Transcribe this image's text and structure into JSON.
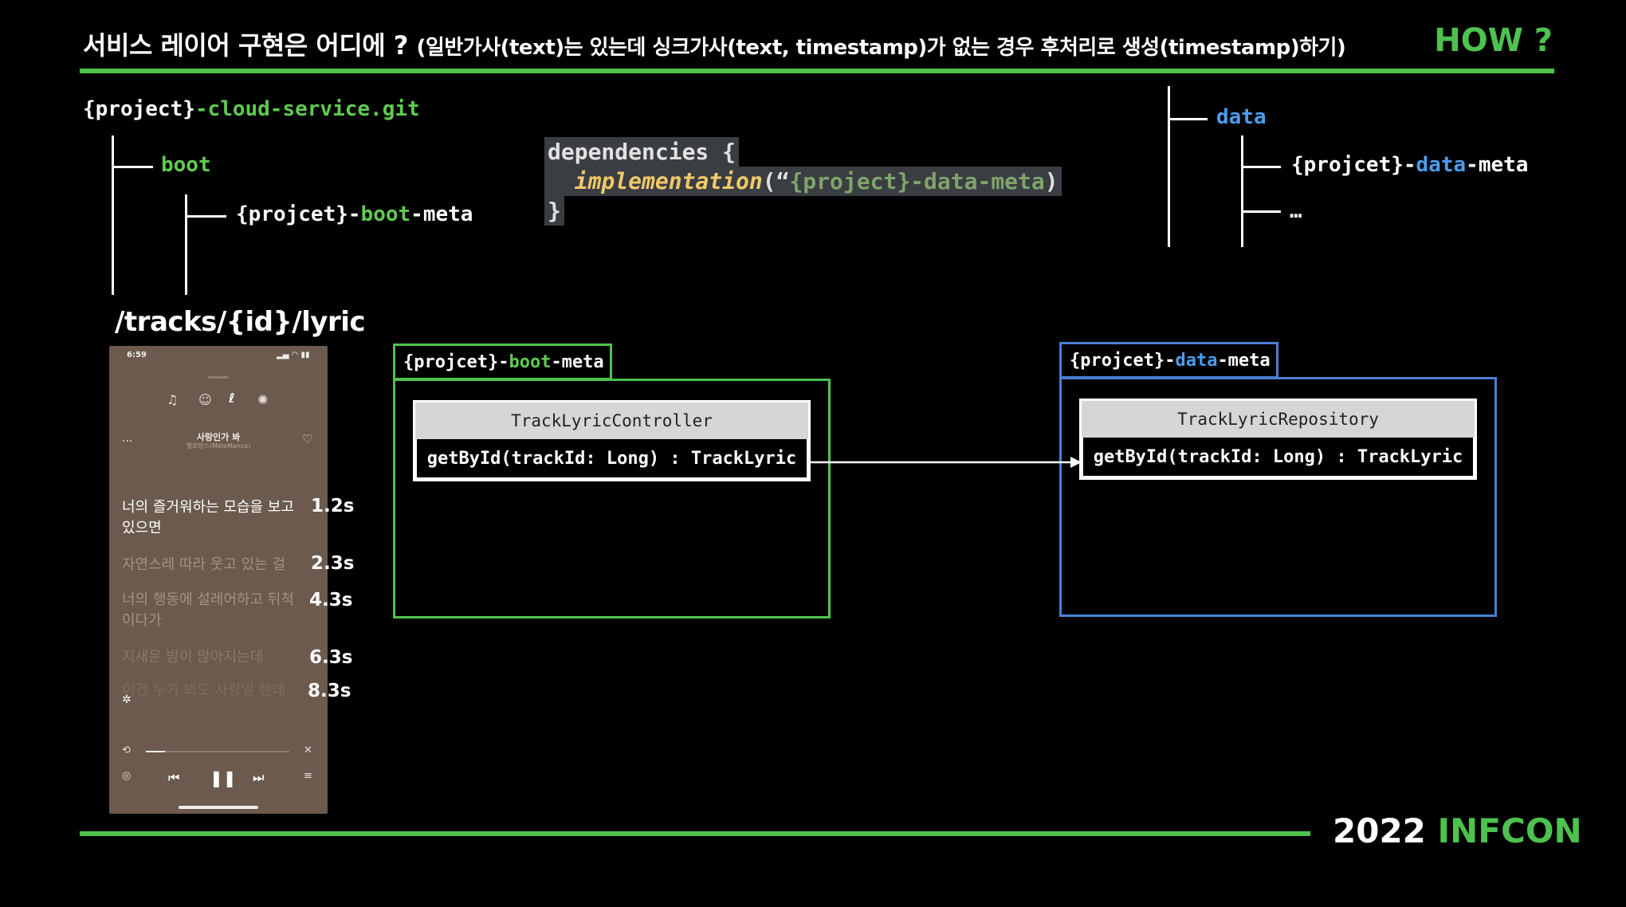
{
  "header": {
    "title_main": "서비스 레이어 구현은 어디에 ?",
    "title_sub": "(일반가사(text)는 있는데 싱크가사(text, timestamp)가 없는 경우 후처리로 생성(timestamp)하기)",
    "how": "HOW ?"
  },
  "tree_left": {
    "repo_prefix": "{project}",
    "repo_suffix": "-cloud-service.git",
    "boot": "boot",
    "module_prefix": "{projcet}-",
    "module_mid": "boot",
    "module_suffix": "-meta"
  },
  "tree_right": {
    "data": "data",
    "module_prefix": "{projcet}-",
    "module_mid": "data",
    "module_suffix": "-meta",
    "ellipsis": "…"
  },
  "code": {
    "line1": "dependencies {",
    "fn": "implementation",
    "open": "(“",
    "arg": "{project}-data-meta",
    "close": ")",
    "line3": "}"
  },
  "route": "/tracks/{id}/lyric",
  "phone": {
    "time": "6:59",
    "song_title": "사랑인가 봐",
    "song_artist": "멜로망스(MeloMance)",
    "lyrics": [
      {
        "text": "너의 즐거워하는 모습을 보고 있으면",
        "ts": "1.2s"
      },
      {
        "text": "자연스레 따라 웃고 있는 걸",
        "ts": "2.3s"
      },
      {
        "text": "너의 행동에 설레어하고 뒤척이다가",
        "ts": "4.3s"
      },
      {
        "text": "지새운 밤이 많아지는데",
        "ts": "6.3s"
      },
      {
        "text": "이건 누가 봐도 사랑일 텐데",
        "ts": "8.3s"
      }
    ]
  },
  "boot_module": {
    "tab_prefix": "{projcet}-",
    "tab_mid": "boot",
    "tab_suffix": "-meta",
    "class_name": "TrackLyricController",
    "method": "getById(trackId: Long) : TrackLyric"
  },
  "data_module": {
    "tab_prefix": "{projcet}-",
    "tab_mid": "data",
    "tab_suffix": "-meta",
    "class_name": "TrackLyricRepository",
    "method": "getById(trackId: Long) : TrackLyric"
  },
  "footer": {
    "year": "2022",
    "name": "INFCON"
  },
  "colors": {
    "green": "#4ec24e",
    "blue": "#4a9ef0"
  }
}
